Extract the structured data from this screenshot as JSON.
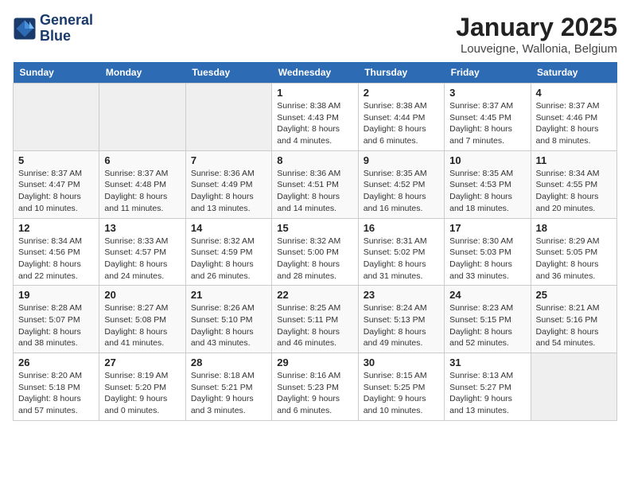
{
  "header": {
    "logo_line1": "General",
    "logo_line2": "Blue",
    "title": "January 2025",
    "subtitle": "Louveigne, Wallonia, Belgium"
  },
  "weekdays": [
    "Sunday",
    "Monday",
    "Tuesday",
    "Wednesday",
    "Thursday",
    "Friday",
    "Saturday"
  ],
  "weeks": [
    [
      {
        "day": "",
        "info": ""
      },
      {
        "day": "",
        "info": ""
      },
      {
        "day": "",
        "info": ""
      },
      {
        "day": "1",
        "info": "Sunrise: 8:38 AM\nSunset: 4:43 PM\nDaylight: 8 hours\nand 4 minutes."
      },
      {
        "day": "2",
        "info": "Sunrise: 8:38 AM\nSunset: 4:44 PM\nDaylight: 8 hours\nand 6 minutes."
      },
      {
        "day": "3",
        "info": "Sunrise: 8:37 AM\nSunset: 4:45 PM\nDaylight: 8 hours\nand 7 minutes."
      },
      {
        "day": "4",
        "info": "Sunrise: 8:37 AM\nSunset: 4:46 PM\nDaylight: 8 hours\nand 8 minutes."
      }
    ],
    [
      {
        "day": "5",
        "info": "Sunrise: 8:37 AM\nSunset: 4:47 PM\nDaylight: 8 hours\nand 10 minutes."
      },
      {
        "day": "6",
        "info": "Sunrise: 8:37 AM\nSunset: 4:48 PM\nDaylight: 8 hours\nand 11 minutes."
      },
      {
        "day": "7",
        "info": "Sunrise: 8:36 AM\nSunset: 4:49 PM\nDaylight: 8 hours\nand 13 minutes."
      },
      {
        "day": "8",
        "info": "Sunrise: 8:36 AM\nSunset: 4:51 PM\nDaylight: 8 hours\nand 14 minutes."
      },
      {
        "day": "9",
        "info": "Sunrise: 8:35 AM\nSunset: 4:52 PM\nDaylight: 8 hours\nand 16 minutes."
      },
      {
        "day": "10",
        "info": "Sunrise: 8:35 AM\nSunset: 4:53 PM\nDaylight: 8 hours\nand 18 minutes."
      },
      {
        "day": "11",
        "info": "Sunrise: 8:34 AM\nSunset: 4:55 PM\nDaylight: 8 hours\nand 20 minutes."
      }
    ],
    [
      {
        "day": "12",
        "info": "Sunrise: 8:34 AM\nSunset: 4:56 PM\nDaylight: 8 hours\nand 22 minutes."
      },
      {
        "day": "13",
        "info": "Sunrise: 8:33 AM\nSunset: 4:57 PM\nDaylight: 8 hours\nand 24 minutes."
      },
      {
        "day": "14",
        "info": "Sunrise: 8:32 AM\nSunset: 4:59 PM\nDaylight: 8 hours\nand 26 minutes."
      },
      {
        "day": "15",
        "info": "Sunrise: 8:32 AM\nSunset: 5:00 PM\nDaylight: 8 hours\nand 28 minutes."
      },
      {
        "day": "16",
        "info": "Sunrise: 8:31 AM\nSunset: 5:02 PM\nDaylight: 8 hours\nand 31 minutes."
      },
      {
        "day": "17",
        "info": "Sunrise: 8:30 AM\nSunset: 5:03 PM\nDaylight: 8 hours\nand 33 minutes."
      },
      {
        "day": "18",
        "info": "Sunrise: 8:29 AM\nSunset: 5:05 PM\nDaylight: 8 hours\nand 36 minutes."
      }
    ],
    [
      {
        "day": "19",
        "info": "Sunrise: 8:28 AM\nSunset: 5:07 PM\nDaylight: 8 hours\nand 38 minutes."
      },
      {
        "day": "20",
        "info": "Sunrise: 8:27 AM\nSunset: 5:08 PM\nDaylight: 8 hours\nand 41 minutes."
      },
      {
        "day": "21",
        "info": "Sunrise: 8:26 AM\nSunset: 5:10 PM\nDaylight: 8 hours\nand 43 minutes."
      },
      {
        "day": "22",
        "info": "Sunrise: 8:25 AM\nSunset: 5:11 PM\nDaylight: 8 hours\nand 46 minutes."
      },
      {
        "day": "23",
        "info": "Sunrise: 8:24 AM\nSunset: 5:13 PM\nDaylight: 8 hours\nand 49 minutes."
      },
      {
        "day": "24",
        "info": "Sunrise: 8:23 AM\nSunset: 5:15 PM\nDaylight: 8 hours\nand 52 minutes."
      },
      {
        "day": "25",
        "info": "Sunrise: 8:21 AM\nSunset: 5:16 PM\nDaylight: 8 hours\nand 54 minutes."
      }
    ],
    [
      {
        "day": "26",
        "info": "Sunrise: 8:20 AM\nSunset: 5:18 PM\nDaylight: 8 hours\nand 57 minutes."
      },
      {
        "day": "27",
        "info": "Sunrise: 8:19 AM\nSunset: 5:20 PM\nDaylight: 9 hours\nand 0 minutes."
      },
      {
        "day": "28",
        "info": "Sunrise: 8:18 AM\nSunset: 5:21 PM\nDaylight: 9 hours\nand 3 minutes."
      },
      {
        "day": "29",
        "info": "Sunrise: 8:16 AM\nSunset: 5:23 PM\nDaylight: 9 hours\nand 6 minutes."
      },
      {
        "day": "30",
        "info": "Sunrise: 8:15 AM\nSunset: 5:25 PM\nDaylight: 9 hours\nand 10 minutes."
      },
      {
        "day": "31",
        "info": "Sunrise: 8:13 AM\nSunset: 5:27 PM\nDaylight: 9 hours\nand 13 minutes."
      },
      {
        "day": "",
        "info": ""
      }
    ]
  ]
}
